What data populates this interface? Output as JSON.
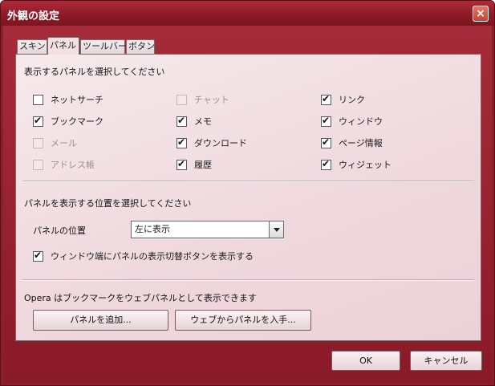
{
  "window": {
    "title": "外観の設定",
    "close_label": "×"
  },
  "tabs": [
    {
      "label": "スキン",
      "active": false
    },
    {
      "label": "パネル",
      "active": true
    },
    {
      "label": "ツールバー",
      "active": false
    },
    {
      "label": "ボタン",
      "active": false
    }
  ],
  "panels_section": {
    "heading": "表示するパネルを選択してください",
    "items": [
      {
        "label": "ネットサーチ",
        "checked": false,
        "enabled": true
      },
      {
        "label": "チャット",
        "checked": false,
        "enabled": false
      },
      {
        "label": "リンク",
        "checked": true,
        "enabled": true
      },
      {
        "label": "ブックマーク",
        "checked": true,
        "enabled": true
      },
      {
        "label": "メモ",
        "checked": true,
        "enabled": true
      },
      {
        "label": "ウィンドウ",
        "checked": true,
        "enabled": true
      },
      {
        "label": "メール",
        "checked": false,
        "enabled": false
      },
      {
        "label": "ダウンロード",
        "checked": true,
        "enabled": true
      },
      {
        "label": "ページ情報",
        "checked": true,
        "enabled": true
      },
      {
        "label": "アドレス帳",
        "checked": false,
        "enabled": false
      },
      {
        "label": "履歴",
        "checked": true,
        "enabled": true
      },
      {
        "label": "ウィジェット",
        "checked": true,
        "enabled": true
      }
    ]
  },
  "position_section": {
    "heading": "パネルを表示する位置を選択してください",
    "position_label": "パネルの位置",
    "position_value": "左に表示",
    "toggle_option": {
      "label": "ウィンドウ端にパネルの表示切替ボタンを表示する",
      "checked": true
    }
  },
  "web_section": {
    "text": "Opera はブックマークをウェブパネルとして表示できます",
    "add_button": "パネルを追加...",
    "get_button": "ウェブからパネルを入手..."
  },
  "footer": {
    "ok_label": "OK",
    "cancel_label": "キャンセル"
  }
}
